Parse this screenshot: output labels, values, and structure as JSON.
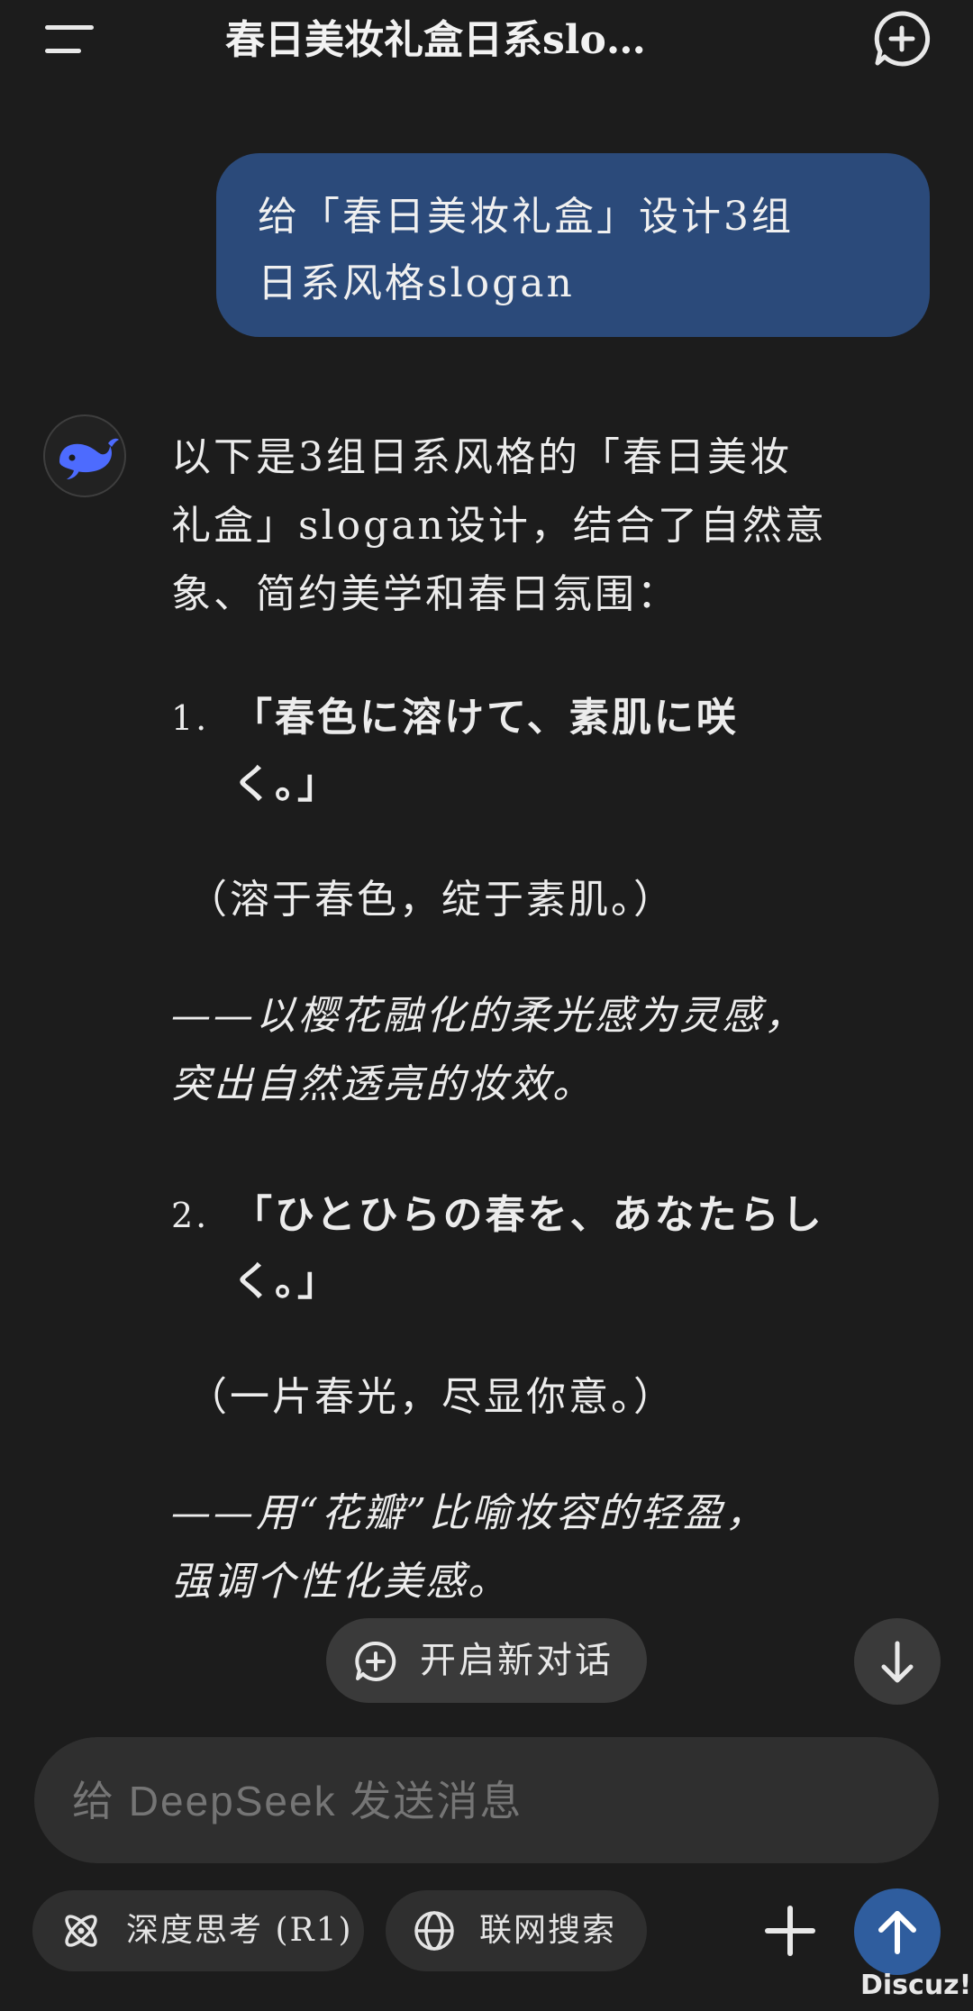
{
  "header": {
    "title": "春日美妆礼盒日系slo…",
    "menu_icon": "menu-icon",
    "new_chat_icon": "plus-bubble-icon"
  },
  "user_message": {
    "line1": "给「春日美妆礼盒」设计3组",
    "line2": "日系风格slogan"
  },
  "assistant": {
    "avatar_icon": "deepseek-whale-icon",
    "intro": [
      "以下是3组日系风格的「春日美妆",
      "礼盒」slogan设计，结合了自然意",
      "象、简约美学和春日氛围："
    ],
    "items": [
      {
        "number": "1.",
        "title_line1": "「春色に溶けて、素肌に咲",
        "title_line2": "く。」",
        "translation": "（溶于春色，绽于素肌。）",
        "note_line1": "——以樱花融化的柔光感为灵感，",
        "note_line2": "突出自然透亮的妆效。"
      },
      {
        "number": "2.",
        "title_line1": "「ひとひらの春を、あなたらし",
        "title_line2": "く。」",
        "translation": "（一片春光，尽显你意。）",
        "note_line1": "——用“花瓣”比喻妆容的轻盈，",
        "note_line2": "强调个性化美感。"
      }
    ]
  },
  "floating": {
    "new_chat_label": "开启新对话",
    "new_chat_icon": "plus-bubble-icon",
    "scroll_down_icon": "arrow-down-icon"
  },
  "composer": {
    "placeholder": "给 DeepSeek 发送消息",
    "deep_think_label": "深度思考 (R1)",
    "deep_think_icon": "atom-icon",
    "web_search_label": "联网搜索",
    "web_search_icon": "globe-icon",
    "attach_icon": "plus-icon",
    "send_icon": "arrow-up-icon"
  },
  "watermark": "Discuz!",
  "colors": {
    "background": "#1c1c1c",
    "user_bubble": "#2b4a7a",
    "accent_blue": "#4d6bfe",
    "send_button": "#2f5d9e"
  }
}
